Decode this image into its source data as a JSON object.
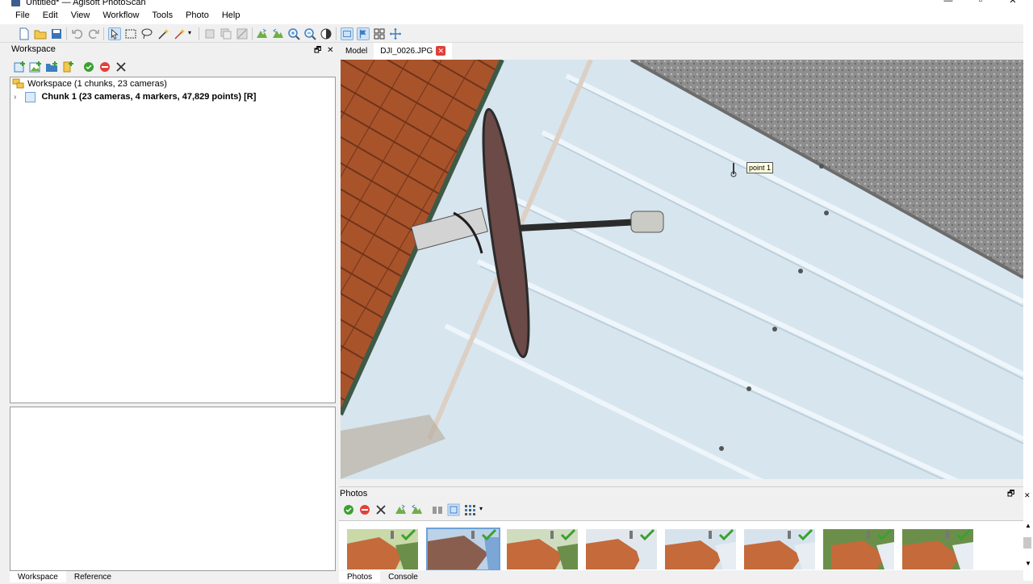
{
  "window": {
    "title": "Untitled* — Agisoft PhotoScan"
  },
  "menu": [
    "File",
    "Edit",
    "View",
    "Workflow",
    "Tools",
    "Photo",
    "Help"
  ],
  "workspace_panel": {
    "title": "Workspace",
    "root": "Workspace (1 chunks, 23 cameras)",
    "chunk": "Chunk 1 (23 cameras, 4 markers, 47,829 points) [R]"
  },
  "bottom_tabs": [
    "Workspace",
    "Reference"
  ],
  "view_tabs": {
    "model": "Model",
    "photo": "DJI_0026.JPG"
  },
  "viewer": {
    "marker_label": "point 1"
  },
  "photos_panel": {
    "title": "Photos",
    "tabs": [
      "Photos",
      "Console"
    ],
    "thumbnail_count": 8
  },
  "colors": {
    "accent": "#3c7fc1",
    "close_red": "#e0403a",
    "ok_green": "#3aa12f",
    "roof": "#d9e6ee",
    "tile": "#a9532b"
  },
  "icons": [
    "new-icon",
    "open-icon",
    "save-icon",
    "undo-icon",
    "redo-icon",
    "navigation-icon",
    "rect-select-icon",
    "lasso-icon",
    "magic-wand-icon",
    "zoom-in-icon",
    "zoom-out-icon"
  ]
}
